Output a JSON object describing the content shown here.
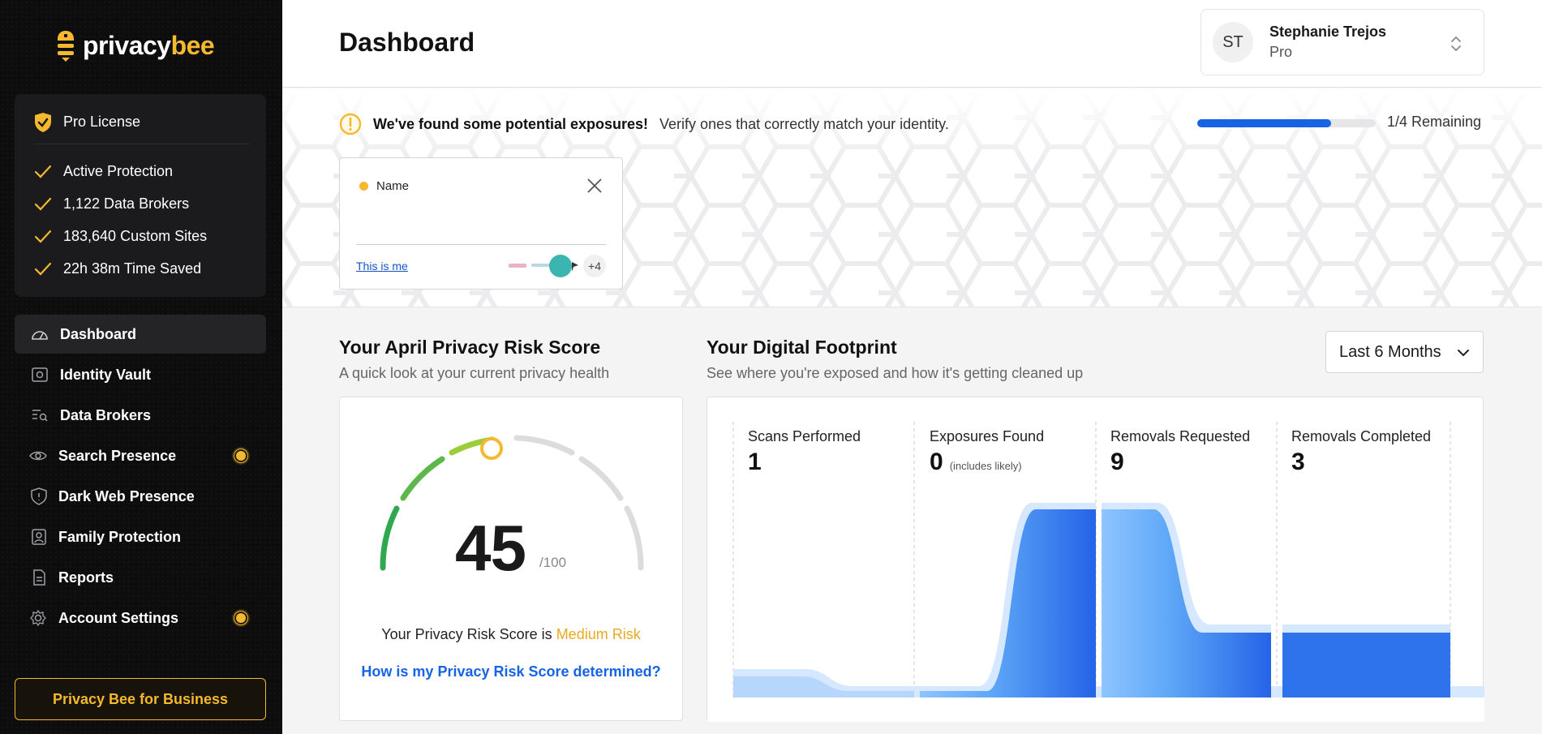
{
  "brand": {
    "part1": "privacy",
    "part2": "bee",
    "accent": "#f5b82e"
  },
  "license": {
    "title": "Pro License",
    "features": [
      {
        "label": "Active Protection"
      },
      {
        "label": "1,122 Data Brokers"
      },
      {
        "label": "183,640 Custom Sites"
      },
      {
        "label": "22h 38m Time Saved"
      }
    ]
  },
  "nav": [
    {
      "label": "Dashboard",
      "icon": "dashboard-icon",
      "active": true
    },
    {
      "label": "Identity Vault",
      "icon": "vault-icon"
    },
    {
      "label": "Data Brokers",
      "icon": "data-brokers-icon"
    },
    {
      "label": "Search Presence",
      "icon": "eye-icon",
      "badge": true
    },
    {
      "label": "Dark Web Presence",
      "icon": "shield-icon"
    },
    {
      "label": "Family Protection",
      "icon": "family-icon"
    },
    {
      "label": "Reports",
      "icon": "reports-icon"
    },
    {
      "label": "Account Settings",
      "icon": "gear-icon",
      "badge": true
    }
  ],
  "business_button": "Privacy Bee for Business",
  "header": {
    "title": "Dashboard"
  },
  "user": {
    "initials": "ST",
    "name": "Stephanie Trejos",
    "plan": "Pro"
  },
  "exposures": {
    "headline": "We've found some potential exposures!",
    "subtext": "Verify ones that correctly match your identity.",
    "progress": 0.75,
    "remaining": "1/4 Remaining",
    "card": {
      "field": "Name",
      "action": "This is me",
      "more": "+4"
    }
  },
  "score": {
    "title": "Your April Privacy Risk Score",
    "subtitle": "A quick look at your current privacy health",
    "value": "45",
    "max": "/100",
    "risk_prefix": "Your Privacy Risk Score is",
    "risk_level": "Medium Risk",
    "link": "How is my Privacy Risk Score determined?"
  },
  "footprint": {
    "title": "Your Digital Footprint",
    "subtitle": "See where you're exposed and how it's getting cleaned up",
    "period": "Last 6 Months",
    "metrics": [
      {
        "label": "Scans Performed",
        "value": "1",
        "note": ""
      },
      {
        "label": "Exposures Found",
        "value": "0",
        "note": "(includes likely)"
      },
      {
        "label": "Removals Requested",
        "value": "9",
        "note": ""
      },
      {
        "label": "Removals Completed",
        "value": "3",
        "note": ""
      }
    ]
  }
}
